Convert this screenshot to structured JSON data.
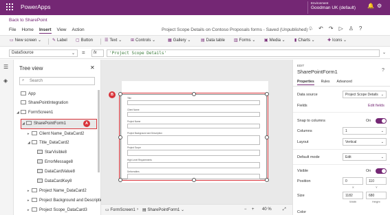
{
  "app": {
    "title": "PowerApps",
    "environment_label": "Environment",
    "environment_name": "Goodman UK (default)",
    "back_link": "Back to SharePoint",
    "doc_title": "Project Scope Details on Contoso Proposals forms - Saved (Unpublished)"
  },
  "menu": {
    "tabs": [
      {
        "label": "File"
      },
      {
        "label": "Home"
      },
      {
        "label": "Insert",
        "active": true
      },
      {
        "label": "View"
      },
      {
        "label": "Action"
      }
    ]
  },
  "ribbon": {
    "new_screen": "New screen",
    "label": "Label",
    "button": "Button",
    "text": "Text",
    "controls": "Controls",
    "gallery": "Gallery",
    "data_table": "Data table",
    "forms": "Forms",
    "media": "Media",
    "charts": "Charts",
    "icons": "Icons"
  },
  "formula_bar": {
    "property": "DataSource",
    "equals": "=",
    "fx": "fx",
    "value": "'Project Scope Details'"
  },
  "tree": {
    "title": "Tree view",
    "search_placeholder": "Search",
    "nodes": [
      {
        "label": "App"
      },
      {
        "label": "SharePointIntegration"
      },
      {
        "label": "FormScreen1"
      },
      {
        "label": "SharePointForm1"
      },
      {
        "label": "Client Name_DataCard2"
      },
      {
        "label": "Title_DataCard2"
      },
      {
        "label": "StarVisible8"
      },
      {
        "label": "ErrorMessage8"
      },
      {
        "label": "DataCardValue8"
      },
      {
        "label": "DataCardKey8"
      },
      {
        "label": "Project Name_DataCard2"
      },
      {
        "label": "Project Background and Description"
      },
      {
        "label": "Project Scope_DataCard3"
      }
    ]
  },
  "canvas": {
    "fields": [
      {
        "label": "Title"
      },
      {
        "label": "Client Name"
      },
      {
        "label": "Project Name"
      },
      {
        "label": "Project Background and Description"
      },
      {
        "label": "Project Scope"
      },
      {
        "label": "High Level Requirements"
      },
      {
        "label": "Deliverables"
      }
    ]
  },
  "status": {
    "screen": "FormScreen1",
    "form": "SharePointForm1",
    "minus": "−",
    "plus": "+",
    "zoom": "40",
    "zoom_unit": "%"
  },
  "callouts": {
    "a": "A",
    "b": "B"
  },
  "properties": {
    "header": "EDIT",
    "name": "SharePointForm1",
    "tabs": [
      {
        "label": "Properties",
        "active": true
      },
      {
        "label": "Rules"
      },
      {
        "label": "Advanced"
      }
    ],
    "data_source_label": "Data source",
    "data_source_value": "Project Scope Details",
    "fields_label": "Fields",
    "edit_fields": "Edit fields",
    "snap_label": "Snap to columns",
    "snap_value": "On",
    "columns_label": "Columns",
    "columns_value": "1",
    "layout_label": "Layout",
    "layout_value": "Vertical",
    "default_mode_label": "Default mode",
    "default_mode_value": "Edit",
    "visible_label": "Visible",
    "visible_value": "On",
    "position_label": "Position",
    "x_value": "0",
    "y_value": "110",
    "x_label": "X",
    "y_label": "Y",
    "size_label": "Size",
    "width_value": "1182",
    "height_value": "680",
    "width_label": "Width",
    "height_label": "Height",
    "color_label": "Color"
  }
}
